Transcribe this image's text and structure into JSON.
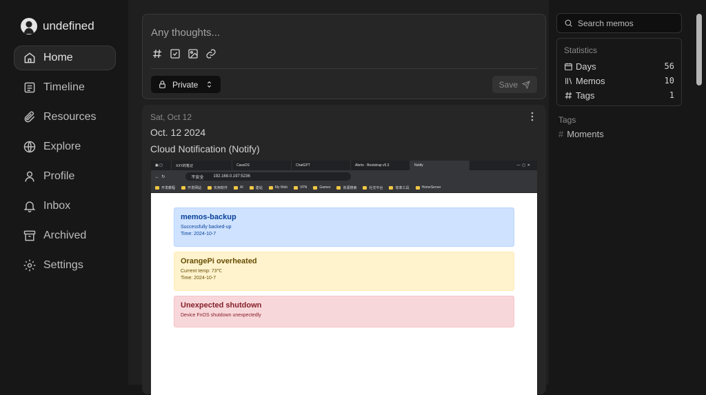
{
  "brand": {
    "name": "undefined"
  },
  "nav": [
    {
      "label": "Home"
    },
    {
      "label": "Timeline"
    },
    {
      "label": "Resources"
    },
    {
      "label": "Explore"
    },
    {
      "label": "Profile"
    },
    {
      "label": "Inbox"
    },
    {
      "label": "Archived"
    },
    {
      "label": "Settings"
    }
  ],
  "editor": {
    "placeholder": "Any thoughts...",
    "visibility": "Private",
    "save_label": "Save"
  },
  "memo": {
    "date": "Sat, Oct 12",
    "line1": "Oct. 12 2024",
    "line2": "Cloud Notification (Notify)"
  },
  "screenshot": {
    "tabs": [
      "XXY的笔记",
      "CasaOS",
      "ChatGPT",
      "Alerts · Bootstrap v5.3",
      "Notify"
    ],
    "insecure_label": "不安全",
    "url": "192.168.0.197:5236",
    "bookmarks": [
      "开发教程",
      "开发网站",
      "实用软件",
      "AI",
      "建站",
      "My Web",
      "VPN",
      "Games",
      "资源搜索",
      "社交平台",
      "效率工具",
      "HomeServer"
    ],
    "alerts": [
      {
        "title": "memos-backup",
        "lines": [
          "Successfully backed-up",
          "Time: 2024-10-7"
        ]
      },
      {
        "title": "OrangePi overheated",
        "lines": [
          "Current temp: 73℃",
          "Time: 2024-10-7"
        ]
      },
      {
        "title": "Unexpected shutdown",
        "lines": [
          "Device FnOS shutdown unexpectedly"
        ]
      }
    ]
  },
  "search": {
    "placeholder": "Search memos"
  },
  "statistics": {
    "title": "Statistics",
    "rows": [
      {
        "label": "Days",
        "value": "56"
      },
      {
        "label": "Memos",
        "value": "10"
      },
      {
        "label": "Tags",
        "value": "1"
      }
    ]
  },
  "tags": {
    "title": "Tags",
    "items": [
      {
        "label": "Moments"
      }
    ]
  }
}
